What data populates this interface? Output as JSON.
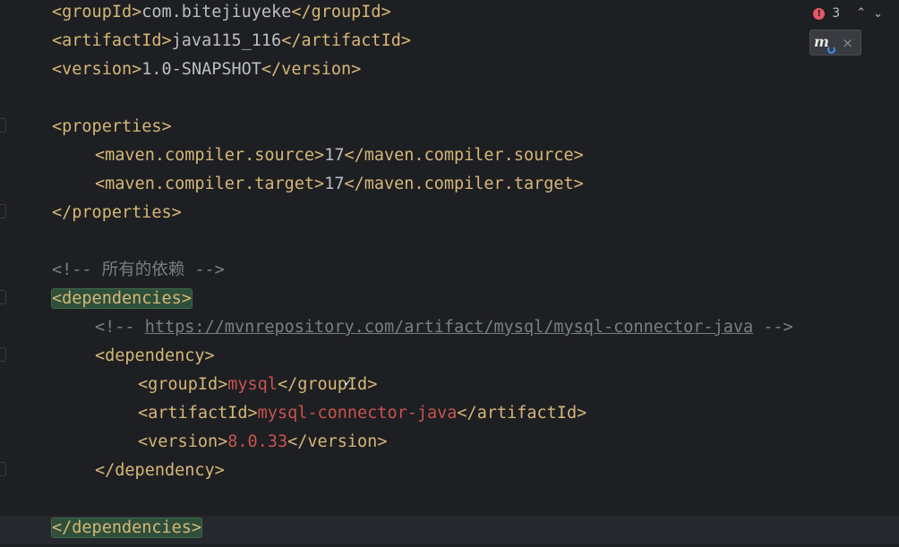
{
  "status": {
    "error_count": "3",
    "error_icon": "error-circle-icon",
    "nav_up": "chevron-up-icon",
    "nav_down": "chevron-down-icon"
  },
  "maven_popup": {
    "icon": "maven-reload-icon",
    "icon_text": "m",
    "close": "×"
  },
  "code": {
    "l1": {
      "o": "<groupId>",
      "t": "com.bitejiuyeke",
      "c": "</groupId>"
    },
    "l2": {
      "o": "<artifactId>",
      "t": "java115_116",
      "c": "</artifactId>"
    },
    "l3": {
      "o": "<version>",
      "t": "1.0-SNAPSHOT",
      "c": "</version>"
    },
    "l4": {
      "o": "<properties>"
    },
    "l5": {
      "o": "<maven.compiler.source>",
      "t": "17",
      "c": "</maven.compiler.source>"
    },
    "l6": {
      "o": "<maven.compiler.target>",
      "t": "17",
      "c": "</maven.compiler.target>"
    },
    "l7": {
      "o": "</properties>"
    },
    "l8": {
      "comment": "<!-- 所有的依赖 -->"
    },
    "l9": {
      "o": "<dependencies>"
    },
    "l10": {
      "pre": "<!-- ",
      "link": "https://mvnrepository.com/artifact/mysql/mysql-connector-java",
      "post": " -->"
    },
    "l11": {
      "o": "<dependency>"
    },
    "l12": {
      "o": "<groupId>",
      "t": "mysql",
      "c": "</groupId>"
    },
    "l13": {
      "o": "<artifactId>",
      "t": "mysql-connector-java",
      "c": "</artifactId>"
    },
    "l14": {
      "o": "<version>",
      "t": "8.0.33",
      "c": "</version>"
    },
    "l15": {
      "o": "</dependency>"
    },
    "l16": {
      "o": "</dependencies>"
    }
  }
}
